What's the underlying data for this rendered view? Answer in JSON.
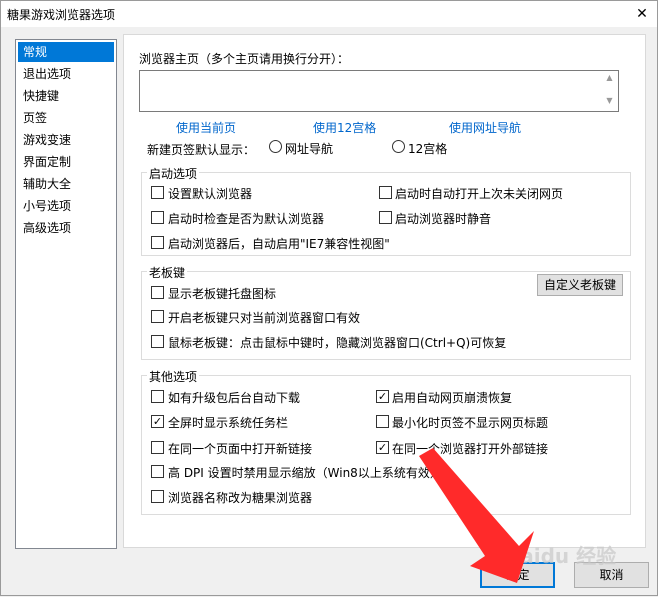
{
  "window": {
    "title": "糖果游戏浏览器选项",
    "close_glyph": "✕"
  },
  "nav": {
    "items": [
      {
        "label": "常规",
        "selected": true
      },
      {
        "label": "退出选项"
      },
      {
        "label": "快捷键"
      },
      {
        "label": "页签"
      },
      {
        "label": "游戏变速"
      },
      {
        "label": "界面定制"
      },
      {
        "label": "辅助大全"
      },
      {
        "label": "小号选项"
      },
      {
        "label": "高级选项"
      }
    ]
  },
  "homepage": {
    "label": "浏览器主页（多个主页请用换行分开）：",
    "value": "",
    "links": [
      "使用当前页",
      "使用12宫格",
      "使用网址导航"
    ]
  },
  "newtab": {
    "label": "新建页签默认显示：",
    "options": [
      "网址导航",
      "12宫格"
    ]
  },
  "startup": {
    "title": "启动选项",
    "items": [
      {
        "label": "设置默认浏览器",
        "checked": false
      },
      {
        "label": "启动时自动打开上次未关闭网页",
        "checked": false
      },
      {
        "label": "启动时检查是否为默认浏览器",
        "checked": false
      },
      {
        "label": "启动浏览器时静音",
        "checked": false
      },
      {
        "label": "启动浏览器后，自动启用\"IE7兼容性视图\"",
        "checked": false
      }
    ]
  },
  "bosskey": {
    "title": "老板键",
    "button": "自定义老板键",
    "items": [
      {
        "label": "显示老板键托盘图标",
        "checked": false
      },
      {
        "label": "开启老板键只对当前浏览器窗口有效",
        "checked": false
      },
      {
        "label": "鼠标老板键：点击鼠标中键时，隐藏浏览器窗口(Ctrl+Q)可恢复",
        "checked": false
      }
    ]
  },
  "other": {
    "title": "其他选项",
    "items": [
      {
        "label": "如有升级包后台自动下载",
        "checked": false
      },
      {
        "label": "启用自动网页崩溃恢复",
        "checked": true
      },
      {
        "label": "全屏时显示系统任务栏",
        "checked": true
      },
      {
        "label": "最小化时页签不显示网页标题",
        "checked": false
      },
      {
        "label": "在同一个页面中打开新链接",
        "checked": false
      },
      {
        "label": "在同一个浏览器打开外部链接",
        "checked": true
      },
      {
        "label": "高 DPI 设置时禁用显示缩放（Win8以上系统有效）",
        "checked": false
      },
      {
        "label": "浏览器名称改为糖果浏览器",
        "checked": false
      }
    ]
  },
  "footer": {
    "ok": "确定",
    "cancel": "取消"
  },
  "watermark": "Baidu 经验",
  "colors": {
    "accent": "#0078d7",
    "link": "#0066cc",
    "arrow": "#ff2a2a"
  }
}
